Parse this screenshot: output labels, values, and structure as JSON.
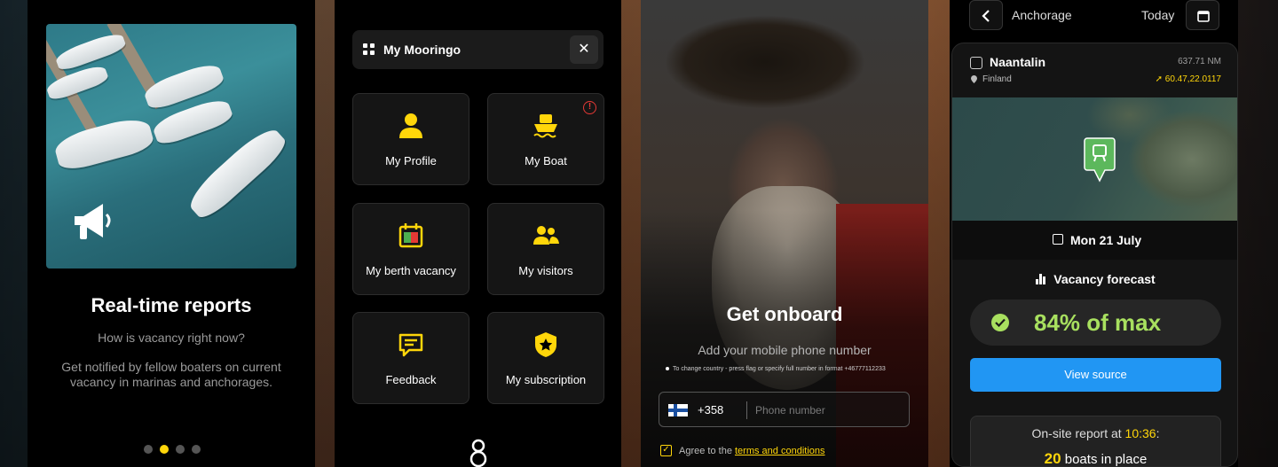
{
  "screen1": {
    "title": "Real-time reports",
    "subtitle": "How is vacancy right now?",
    "description": "Get notified by fellow boaters on current vacancy in marinas and anchorages.",
    "pagination": {
      "pages": 4,
      "active": 2
    }
  },
  "screen2": {
    "header_title": "My Mooringo",
    "tiles": [
      {
        "label": "My Profile",
        "icon": "person-icon"
      },
      {
        "label": "My Boat",
        "icon": "boat-icon",
        "alert": true
      },
      {
        "label": "My berth vacancy",
        "icon": "calendar-vacancy-icon"
      },
      {
        "label": "My visitors",
        "icon": "people-icon"
      },
      {
        "label": "Feedback",
        "icon": "message-icon"
      },
      {
        "label": "My subscription",
        "icon": "star-shield-icon"
      }
    ]
  },
  "screen3": {
    "title": "Get onboard",
    "subtitle": "Add your mobile phone number",
    "hint": "To change country - press flag or specify full number in format +46777112233",
    "country_code": "+358",
    "phone_placeholder": "Phone number",
    "agree_prefix": "Agree to the",
    "terms_link": "terms and conditions"
  },
  "screen4": {
    "header_title": "Anchorage",
    "today_label": "Today",
    "location_name": "Naantalin",
    "distance": "637.71 NM",
    "country": "Finland",
    "coordinates": "60.47,22.0117",
    "date": "Mon 21 July",
    "forecast_label": "Vacancy forecast",
    "forecast_value": "84% of max",
    "view_source": "View source",
    "report_prefix": "On-site report at",
    "report_time": "10:36",
    "report_suffix": ":",
    "boats_count": "20",
    "boats_label": "boats in place"
  },
  "colors": {
    "accent_yellow": "#ffd60a",
    "forecast_green": "#a8e05f",
    "button_blue": "#2196f3",
    "alert_red": "#e53935"
  }
}
